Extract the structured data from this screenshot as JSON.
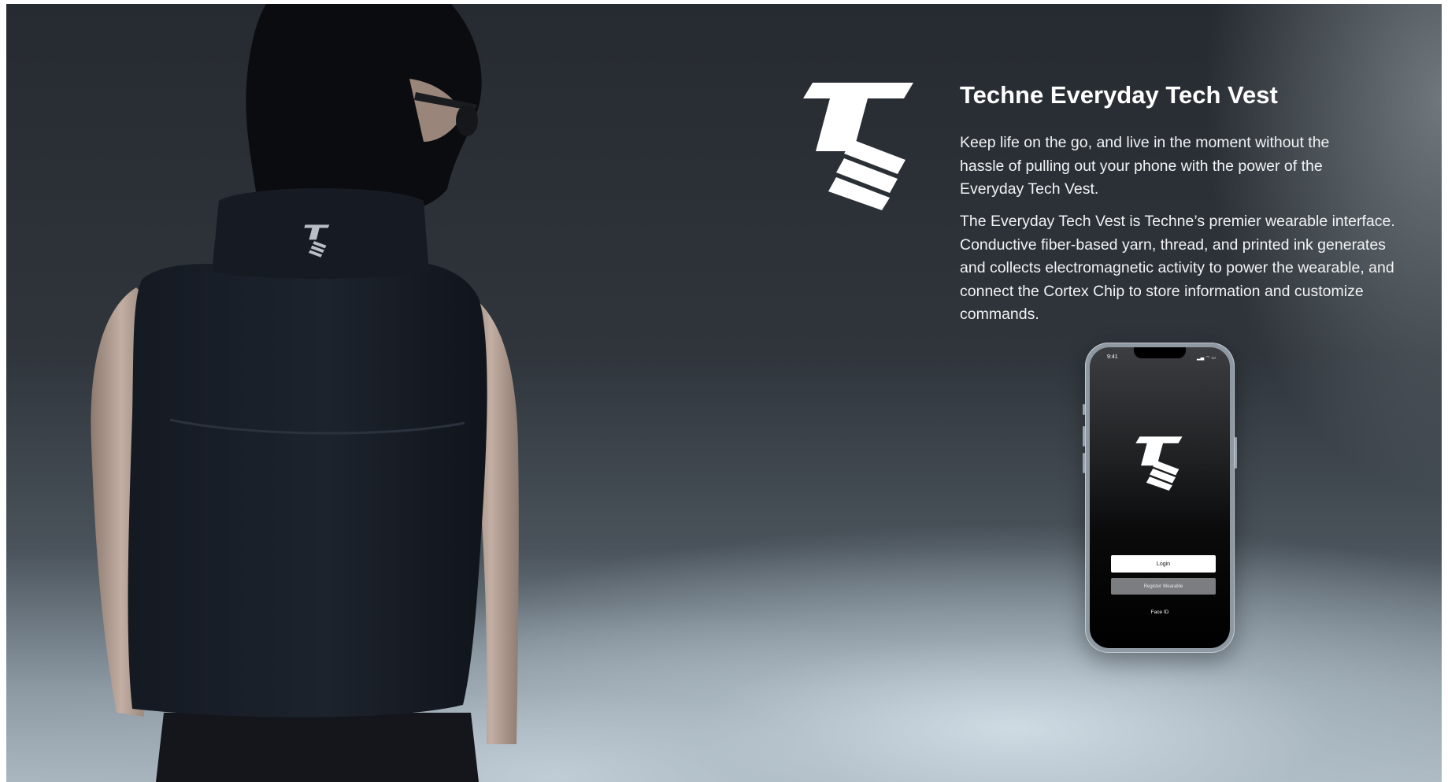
{
  "product": {
    "title": "Techne Everyday Tech Vest",
    "paragraphs": [
      "Keep life on the go, and live in the moment without the hassle of pulling out your phone with the power of the Everyday Tech Vest.",
      "The Everyday Tech Vest is Techne’s premier wearable interface. Conductive fiber-based yarn, thread, and printed ink generates and collects electromagnetic activity to power the wearable, and connect the Cortex Chip to store information and customize commands."
    ]
  },
  "phone": {
    "status_time": "9:41",
    "status_icons": "▂▄ ◠ ▭",
    "login_label": "Login",
    "register_label": "Register Wearable",
    "faceid_label": "Face ID"
  },
  "colors": {
    "text": "#ffffff",
    "background_dark": "#2a2f35",
    "register_button": "#7b7d80"
  },
  "icons": {
    "brand_logo": "techne-logo",
    "vest_logo": "techne-logo",
    "app_logo": "techne-logo"
  }
}
